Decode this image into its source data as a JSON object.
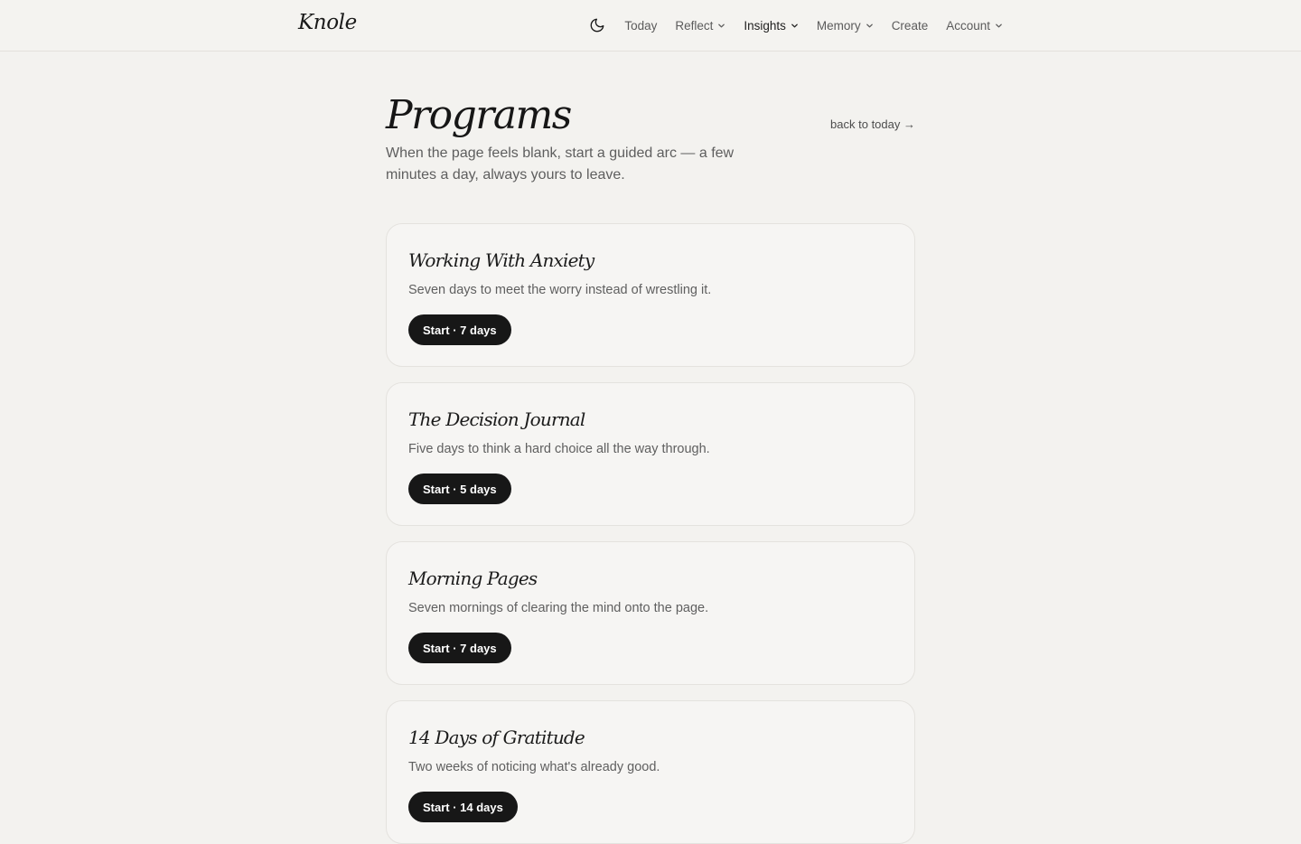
{
  "header": {
    "brand": "Knole",
    "theme_toggle_icon": "moon-icon",
    "nav": [
      {
        "label": "Today",
        "has_menu": false
      },
      {
        "label": "Reflect",
        "has_menu": true
      },
      {
        "label": "Insights",
        "has_menu": true,
        "active": true
      },
      {
        "label": "Memory",
        "has_menu": true
      },
      {
        "label": "Create",
        "has_menu": false
      },
      {
        "label": "Account",
        "has_menu": true
      }
    ]
  },
  "page": {
    "title": "Programs",
    "subtitle": "When the page feels blank, start a guided arc — a few minutes a day, always yours to leave.",
    "back_link": "back to today →"
  },
  "programs": [
    {
      "title": "Working With Anxiety",
      "description": "Seven days to meet the worry instead of wrestling it.",
      "button": "Start · 7 days"
    },
    {
      "title": "The Decision Journal",
      "description": "Five days to think a hard choice all the way through.",
      "button": "Start · 5 days"
    },
    {
      "title": "Morning Pages",
      "description": "Seven mornings of clearing the mind onto the page.",
      "button": "Start · 7 days"
    },
    {
      "title": "14 Days of Gratitude",
      "description": "Two weeks of noticing what's already good.",
      "button": "Start · 14 days"
    }
  ],
  "colors": {
    "background": "#f3f2ef",
    "card": "#f6f5f3",
    "button": "#171717",
    "text": "#1a1a1a",
    "muted": "#5e5e5e"
  }
}
